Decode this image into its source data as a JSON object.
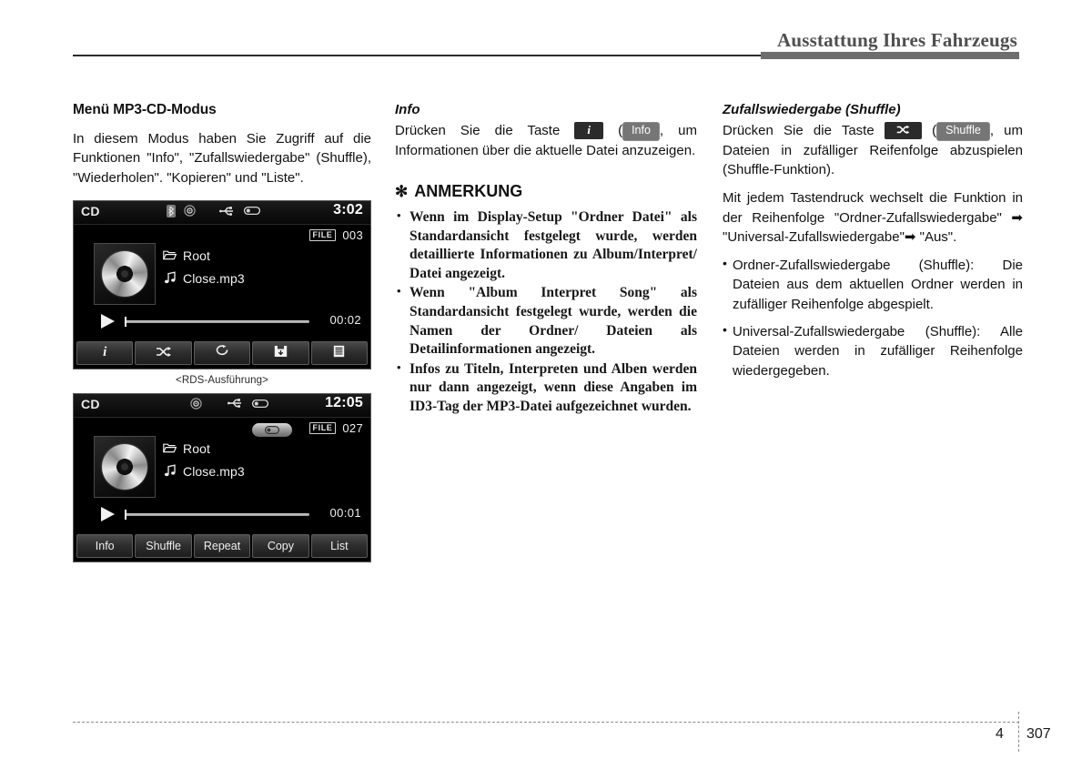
{
  "header": {
    "title": "Ausstattung Ihres Fahrzeugs"
  },
  "left_column": {
    "section_title": "Menü MP3-CD-Modus",
    "intro": "In diesem Modus haben Sie Zugriff auf die Funktionen \"Info\", \"Zufallswiedergabe\" (Shuffle), \"Wiederholen\". \"Kopieren\" und \"Liste\".",
    "caption": "<RDS-Ausführung>",
    "screen1": {
      "source": "CD",
      "clock": "3:02",
      "file_label": "FILE",
      "file_number": "003",
      "folder": "Root",
      "track": "Close.mp3",
      "elapsed": "00:02",
      "status_icons": [
        "bluetooth-icon",
        "disc-icon",
        "usb-icon",
        "ipod-icon"
      ],
      "buttons": [
        "info-icon",
        "shuffle-icon",
        "repeat-icon",
        "copy-icon",
        "list-icon"
      ]
    },
    "screen2": {
      "source": "CD",
      "clock": "12:05",
      "file_label": "FILE",
      "file_number": "027",
      "folder": "Root",
      "track": "Close.mp3",
      "elapsed": "00:01",
      "status_icons": [
        "disc-icon",
        "usb-icon",
        "ipod-icon"
      ],
      "buttons": [
        "Info",
        "Shuffle",
        "Repeat",
        "Copy",
        "List"
      ]
    }
  },
  "mid_column": {
    "sub_title": "Info",
    "para_before_keys": "Drücken Sie die Taste",
    "key_icon": "i",
    "key_alt_label": "Info",
    "para_after_keys": ", um Informationen über die aktuelle Datei anzuzeigen.",
    "note_star": "✻",
    "note_heading": "ANMERKUNG",
    "note_items": [
      "Wenn im Display-Setup \"Ordner Datei\" als Standardansicht festgelegt wurde, werden detaillierte Informationen zu Album/Interpret/ Datei angezeigt.",
      "Wenn \"Album Interpret Song\" als Standardansicht festgelegt wurde, werden die Namen der Ordner/ Dateien als Detailinformationen angezeigt.",
      "Infos zu Titeln, Interpreten und Alben werden nur dann angezeigt, wenn diese Angaben im ID3-Tag der MP3-Datei aufgezeichnet wurden."
    ]
  },
  "right_column": {
    "sub_title": "Zufallswiedergabe (Shuffle)",
    "para_before_keys": "Drücken Sie die Taste",
    "key_icon": "⤨",
    "key_alt_label": "Shuffle",
    "para_after_keys": ", um Dateien in zufälliger Reifenfolge abzuspielen (Shuffle-Funktion).",
    "para2": "Mit jedem Tastendruck wechselt die Funktion in der Reihenfolge \"Ordner-Zufallswiedergabe\" ➡ \"Universal-Zufallswiedergabe\"➡ \"Aus\".",
    "bullets": [
      "Ordner-Zufallswiedergabe (Shuffle): Die Dateien aus dem aktuellen Ordner werden in zufälliger Reihenfolge abgespielt.",
      "Universal-Zufallswiedergabe (Shuffle): Alle Dateien werden in zufälliger Reihenfolge wiedergegeben."
    ]
  },
  "footer": {
    "chapter": "4",
    "page": "307"
  }
}
